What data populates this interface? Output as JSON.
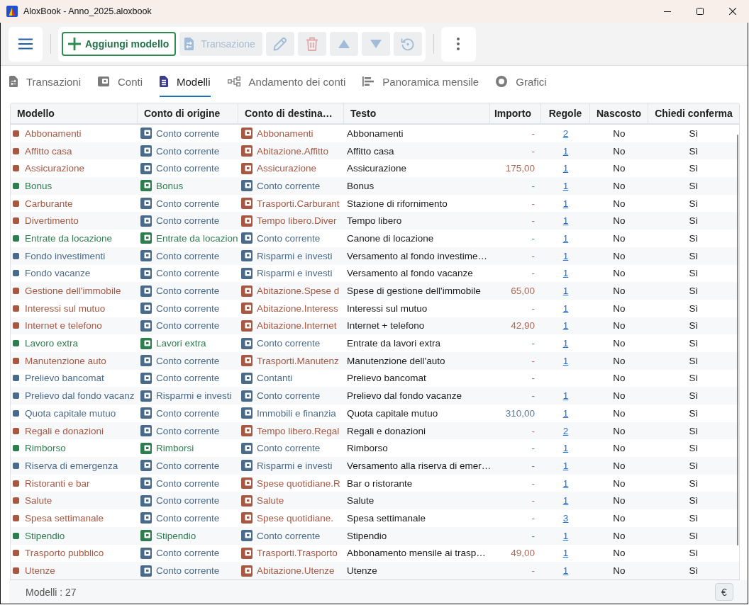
{
  "window": {
    "title": "AloxBook - Anno_2025.aloxbook"
  },
  "toolbar": {
    "buttons": [
      {
        "kind": "add",
        "label": "Aggiungi modello",
        "disabled": false
      },
      {
        "kind": "transaction",
        "label": "Transazione",
        "disabled": true
      },
      {
        "kind": "edit",
        "disabled": true
      },
      {
        "kind": "delete",
        "disabled": true
      },
      {
        "kind": "up",
        "disabled": true
      },
      {
        "kind": "down",
        "disabled": true
      },
      {
        "kind": "history",
        "disabled": true
      }
    ]
  },
  "tabs": [
    {
      "kind": "transactions",
      "label": "Transazioni",
      "selected": false
    },
    {
      "kind": "accounts",
      "label": "Conti",
      "selected": false
    },
    {
      "kind": "templates",
      "label": "Modelli",
      "selected": true
    },
    {
      "kind": "flow",
      "label": "Andamento dei conti",
      "selected": false
    },
    {
      "kind": "overview",
      "label": "Panoramica mensile",
      "selected": false
    },
    {
      "kind": "charts",
      "label": "Grafici",
      "selected": false
    }
  ],
  "table": {
    "columns": [
      "Modello",
      "Conto di origine",
      "Conto di destina…",
      "Testo",
      "Importo",
      "Regole",
      "Nascosto",
      "Chiedi conferma"
    ],
    "rows": [
      {
        "name": "Abbonamenti",
        "color": "#a65843",
        "origin": {
          "name": "Conto corrente",
          "color": "#4a6a8a"
        },
        "destination": {
          "name": "Abbonamenti",
          "color": "#a65843"
        },
        "text": "Abbonamenti",
        "amount": "-",
        "rules": "2",
        "hidden": "No",
        "confirm": "Sì"
      },
      {
        "name": "Affitto casa",
        "color": "#a65843",
        "origin": {
          "name": "Conto corrente",
          "color": "#4a6a8a"
        },
        "destination": {
          "name": "Abitazione.Affitto",
          "color": "#a65843"
        },
        "text": "Affitto casa",
        "amount": "-",
        "rules": "1",
        "hidden": "No",
        "confirm": "Sì"
      },
      {
        "name": "Assicurazione",
        "color": "#a65843",
        "origin": {
          "name": "Conto corrente",
          "color": "#4a6a8a"
        },
        "destination": {
          "name": "Assicurazione",
          "color": "#a65843"
        },
        "text": "Assicurazione",
        "amount": "175,00",
        "rules": "1",
        "hidden": "No",
        "confirm": "Sì"
      },
      {
        "name": "Bonus",
        "color": "#2e7d4f",
        "origin": {
          "name": "Bonus",
          "color": "#2e7d4f"
        },
        "destination": {
          "name": "Conto corrente",
          "color": "#4a6a8a"
        },
        "text": "Bonus",
        "amount": "-",
        "rules": "1",
        "hidden": "No",
        "confirm": "Sì"
      },
      {
        "name": "Carburante",
        "color": "#a65843",
        "origin": {
          "name": "Conto corrente",
          "color": "#4a6a8a"
        },
        "destination": {
          "name": "Trasporti.Carburant",
          "color": "#a65843"
        },
        "text": "Stazione di rifornimento",
        "amount": "-",
        "rules": "1",
        "hidden": "No",
        "confirm": "Sì"
      },
      {
        "name": "Divertimento",
        "color": "#a65843",
        "origin": {
          "name": "Conto corrente",
          "color": "#4a6a8a"
        },
        "destination": {
          "name": "Tempo libero.Diver",
          "color": "#a65843"
        },
        "text": "Tempo libero",
        "amount": "-",
        "rules": "1",
        "hidden": "No",
        "confirm": "Sì"
      },
      {
        "name": "Entrate da locazione",
        "color": "#2e7d4f",
        "origin": {
          "name": "Entrate da locazion",
          "color": "#2e7d4f"
        },
        "destination": {
          "name": "Conto corrente",
          "color": "#4a6a8a"
        },
        "text": "Canone di locazione",
        "amount": "-",
        "rules": "1",
        "hidden": "No",
        "confirm": "Sì"
      },
      {
        "name": "Fondo investimenti",
        "color": "#4a6a8a",
        "origin": {
          "name": "Conto corrente",
          "color": "#4a6a8a"
        },
        "destination": {
          "name": "Risparmi e investi",
          "color": "#4a6a8a"
        },
        "text": "Versamento al fondo investime…",
        "amount": "-",
        "rules": "1",
        "hidden": "No",
        "confirm": "Sì"
      },
      {
        "name": "Fondo vacanze",
        "color": "#4a6a8a",
        "origin": {
          "name": "Conto corrente",
          "color": "#4a6a8a"
        },
        "destination": {
          "name": "Risparmi e investi",
          "color": "#4a6a8a"
        },
        "text": "Versamento al fondo vacanze",
        "amount": "-",
        "rules": "1",
        "hidden": "No",
        "confirm": "Sì"
      },
      {
        "name": "Gestione dell'immobile",
        "color": "#a65843",
        "origin": {
          "name": "Conto corrente",
          "color": "#4a6a8a"
        },
        "destination": {
          "name": "Abitazione.Spese d",
          "color": "#a65843"
        },
        "text": "Spese di gestione dell'immobile",
        "amount": "65,00",
        "rules": "1",
        "hidden": "No",
        "confirm": "Sì"
      },
      {
        "name": "Interessi sul mutuo",
        "color": "#a65843",
        "origin": {
          "name": "Conto corrente",
          "color": "#4a6a8a"
        },
        "destination": {
          "name": "Abitazione.Interess",
          "color": "#a65843"
        },
        "text": "Interessi sul mutuo",
        "amount": "-",
        "rules": "1",
        "hidden": "No",
        "confirm": "Sì"
      },
      {
        "name": "Internet e telefono",
        "color": "#a65843",
        "origin": {
          "name": "Conto corrente",
          "color": "#4a6a8a"
        },
        "destination": {
          "name": "Abitazione.Internet",
          "color": "#a65843"
        },
        "text": "Internet + telefono",
        "amount": "42,90",
        "rules": "1",
        "hidden": "No",
        "confirm": "Sì"
      },
      {
        "name": "Lavoro extra",
        "color": "#2e7d4f",
        "origin": {
          "name": "Lavori extra",
          "color": "#2e7d4f"
        },
        "destination": {
          "name": "Conto corrente",
          "color": "#4a6a8a"
        },
        "text": "Entrate da lavori extra",
        "amount": "-",
        "rules": "1",
        "hidden": "No",
        "confirm": "Sì"
      },
      {
        "name": "Manutenzione auto",
        "color": "#a65843",
        "origin": {
          "name": "Conto corrente",
          "color": "#4a6a8a"
        },
        "destination": {
          "name": "Trasporti.Manutenz",
          "color": "#a65843"
        },
        "text": "Manutenzione dell'auto",
        "amount": "-",
        "rules": "1",
        "hidden": "No",
        "confirm": "Sì"
      },
      {
        "name": "Prelievo bancomat",
        "color": "#4a6a8a",
        "origin": {
          "name": "Conto corrente",
          "color": "#4a6a8a"
        },
        "destination": {
          "name": "Contanti",
          "color": "#4a6a8a"
        },
        "text": "Prelievo bancomat",
        "amount": "-",
        "hidden": "No",
        "confirm": "Sì"
      },
      {
        "name": "Prelievo dal fondo vacanz",
        "color": "#4a6a8a",
        "origin": {
          "name": "Risparmi e investi",
          "color": "#4a6a8a"
        },
        "destination": {
          "name": "Conto corrente",
          "color": "#4a6a8a"
        },
        "text": "Prelievo dal fondo vacanze",
        "amount": "-",
        "rules": "1",
        "hidden": "No",
        "confirm": "Sì"
      },
      {
        "name": "Quota capitale mutuo",
        "color": "#4a6a8a",
        "origin": {
          "name": "Conto corrente",
          "color": "#4a6a8a"
        },
        "destination": {
          "name": "Immobili e finanzia",
          "color": "#4a6a8a"
        },
        "text": "Quota capitale mutuo",
        "amount": "310,00",
        "rules": "1",
        "hidden": "No",
        "confirm": "Sì"
      },
      {
        "name": "Regali e donazioni",
        "color": "#a65843",
        "origin": {
          "name": "Conto corrente",
          "color": "#4a6a8a"
        },
        "destination": {
          "name": "Tempo libero.Regal",
          "color": "#a65843"
        },
        "text": "Regali e donazioni",
        "amount": "-",
        "rules": "2",
        "hidden": "No",
        "confirm": "Sì"
      },
      {
        "name": "Rimborso",
        "color": "#2e7d4f",
        "origin": {
          "name": "Rimborsi",
          "color": "#2e7d4f"
        },
        "destination": {
          "name": "Conto corrente",
          "color": "#4a6a8a"
        },
        "text": "Rimborso",
        "amount": "-",
        "rules": "1",
        "hidden": "No",
        "confirm": "Sì"
      },
      {
        "name": "Riserva di emergenza",
        "color": "#4a6a8a",
        "origin": {
          "name": "Conto corrente",
          "color": "#4a6a8a"
        },
        "destination": {
          "name": "Risparmi e investi",
          "color": "#4a6a8a"
        },
        "text": "Versamento alla riserva di emer…",
        "amount": "-",
        "rules": "1",
        "hidden": "No",
        "confirm": "Sì"
      },
      {
        "name": "Ristoranti e bar",
        "color": "#a65843",
        "origin": {
          "name": "Conto corrente",
          "color": "#4a6a8a"
        },
        "destination": {
          "name": "Spese quotidiane.R",
          "color": "#a65843"
        },
        "text": "Bar o ristorante",
        "amount": "-",
        "rules": "1",
        "hidden": "No",
        "confirm": "Sì"
      },
      {
        "name": "Salute",
        "color": "#a65843",
        "origin": {
          "name": "Conto corrente",
          "color": "#4a6a8a"
        },
        "destination": {
          "name": "Salute",
          "color": "#a65843"
        },
        "text": "Salute",
        "amount": "-",
        "rules": "1",
        "hidden": "No",
        "confirm": "Sì"
      },
      {
        "name": "Spesa settimanale",
        "color": "#a65843",
        "origin": {
          "name": "Conto corrente",
          "color": "#4a6a8a"
        },
        "destination": {
          "name": "Spese quotidiane.",
          "color": "#a65843"
        },
        "text": "Spesa settimanale",
        "amount": "-",
        "rules": "3",
        "hidden": "No",
        "confirm": "Sì"
      },
      {
        "name": "Stipendio",
        "color": "#2e7d4f",
        "origin": {
          "name": "Stipendio",
          "color": "#2e7d4f"
        },
        "destination": {
          "name": "Conto corrente",
          "color": "#4a6a8a"
        },
        "text": "Stipendio",
        "amount": "-",
        "rules": "1",
        "hidden": "No",
        "confirm": "Sì"
      },
      {
        "name": "Trasporto pubblico",
        "color": "#a65843",
        "origin": {
          "name": "Conto corrente",
          "color": "#4a6a8a"
        },
        "destination": {
          "name": "Trasporti.Trasporto",
          "color": "#a65843"
        },
        "text": "Abbonamento mensile ai trasp…",
        "amount": "49,00",
        "rules": "1",
        "hidden": "No",
        "confirm": "Sì"
      },
      {
        "name": "Utenze",
        "color": "#a65843",
        "origin": {
          "name": "Conto corrente",
          "color": "#4a6a8a"
        },
        "destination": {
          "name": "Abitazione.Utenze",
          "color": "#a65843"
        },
        "text": "Utenze",
        "amount": "-",
        "rules": "1",
        "hidden": "No",
        "confirm": "Sì"
      }
    ]
  },
  "status_bar": {
    "count": "Modelli : 27",
    "currency_button": "€"
  }
}
